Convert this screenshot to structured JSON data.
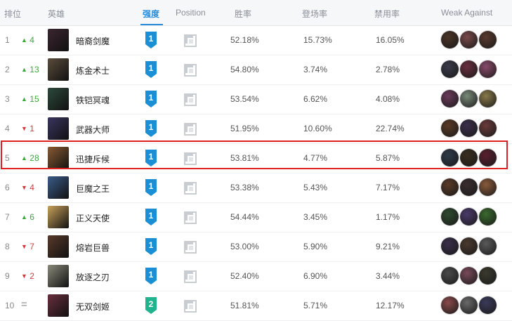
{
  "header": {
    "rank": "排位",
    "hero": "英雄",
    "tier": "强度",
    "position": "Position",
    "win_rate": "胜率",
    "pick_rate": "登场率",
    "ban_rate": "禁用率",
    "weak_against": "Weak Against"
  },
  "colors": {
    "up": "#3ea73e",
    "down": "#d23a3a",
    "tier1": "#1a8fd6",
    "tier2": "#21b38d",
    "highlight": "#e02020"
  },
  "rows": [
    {
      "rank": "1",
      "change": "4",
      "direction": "up",
      "arrow": "▲",
      "name": "暗裔剑魔",
      "tier": "1",
      "win": "52.18%",
      "pick": "15.73%",
      "ban": "16.05%",
      "portrait": "#3b2630"
    },
    {
      "rank": "2",
      "change": "13",
      "direction": "up",
      "arrow": "▲",
      "name": "炼金术士",
      "tier": "1",
      "win": "54.80%",
      "pick": "3.74%",
      "ban": "2.78%",
      "portrait": "#5a4d3c"
    },
    {
      "rank": "3",
      "change": "15",
      "direction": "up",
      "arrow": "▲",
      "name": "铁铠冥魂",
      "tier": "1",
      "win": "53.54%",
      "pick": "6.62%",
      "ban": "4.08%",
      "portrait": "#2d4a3c"
    },
    {
      "rank": "4",
      "change": "1",
      "direction": "down",
      "arrow": "▼",
      "name": "武器大师",
      "tier": "1",
      "win": "51.95%",
      "pick": "10.60%",
      "ban": "22.74%",
      "portrait": "#3a3560"
    },
    {
      "rank": "5",
      "change": "28",
      "direction": "up",
      "arrow": "▲",
      "name": "迅捷斥候",
      "tier": "1",
      "win": "53.81%",
      "pick": "4.77%",
      "ban": "5.87%",
      "portrait": "#8a5a32"
    },
    {
      "rank": "6",
      "change": "4",
      "direction": "down",
      "arrow": "▼",
      "name": "巨魔之王",
      "tier": "1",
      "win": "53.38%",
      "pick": "5.43%",
      "ban": "7.17%",
      "portrait": "#3a5c8a"
    },
    {
      "rank": "7",
      "change": "6",
      "direction": "up",
      "arrow": "▲",
      "name": "正义天使",
      "tier": "1",
      "win": "54.44%",
      "pick": "3.45%",
      "ban": "1.17%",
      "portrait": "#c9a15a"
    },
    {
      "rank": "8",
      "change": "7",
      "direction": "down",
      "arrow": "▼",
      "name": "熔岩巨兽",
      "tier": "1",
      "win": "53.00%",
      "pick": "5.90%",
      "ban": "9.21%",
      "portrait": "#5a3a2a"
    },
    {
      "rank": "9",
      "change": "2",
      "direction": "down",
      "arrow": "▼",
      "name": "放逐之刃",
      "tier": "1",
      "win": "52.40%",
      "pick": "6.90%",
      "ban": "3.44%",
      "portrait": "#8a8a7a"
    },
    {
      "rank": "10",
      "change": "=",
      "direction": "same",
      "arrow": "",
      "name": "无双剑姬",
      "tier": "2",
      "win": "51.81%",
      "pick": "5.71%",
      "ban": "12.17%",
      "portrait": "#6a2e3e"
    }
  ],
  "weak": [
    [
      "#4a3326",
      "#7a4a4a",
      "#5a3a2e"
    ],
    [
      "#3a3a4a",
      "#6a2e3e",
      "#8a4a6a"
    ],
    [
      "#6a3a5a",
      "#7a8a7a",
      "#8a7a4a"
    ],
    [
      "#5a3a26",
      "#3a2e4a",
      "#6a3a3a"
    ],
    [
      "#2e3a4a",
      "#3a2e1e",
      "#5a1e2e"
    ],
    [
      "#5a3a26",
      "#3a2e2e",
      "#8a5a3a"
    ],
    [
      "#2e4a2e",
      "#4a3a6a",
      "#3a6a2e"
    ],
    [
      "#3a2e4a",
      "#4a3a2e",
      "#5a5a5a"
    ],
    [
      "#4a4a4a",
      "#7a4a5a",
      "#3a3a2e"
    ],
    [
      "#8a4a4a",
      "#6a6a6a",
      "#3a3a5a"
    ]
  ]
}
